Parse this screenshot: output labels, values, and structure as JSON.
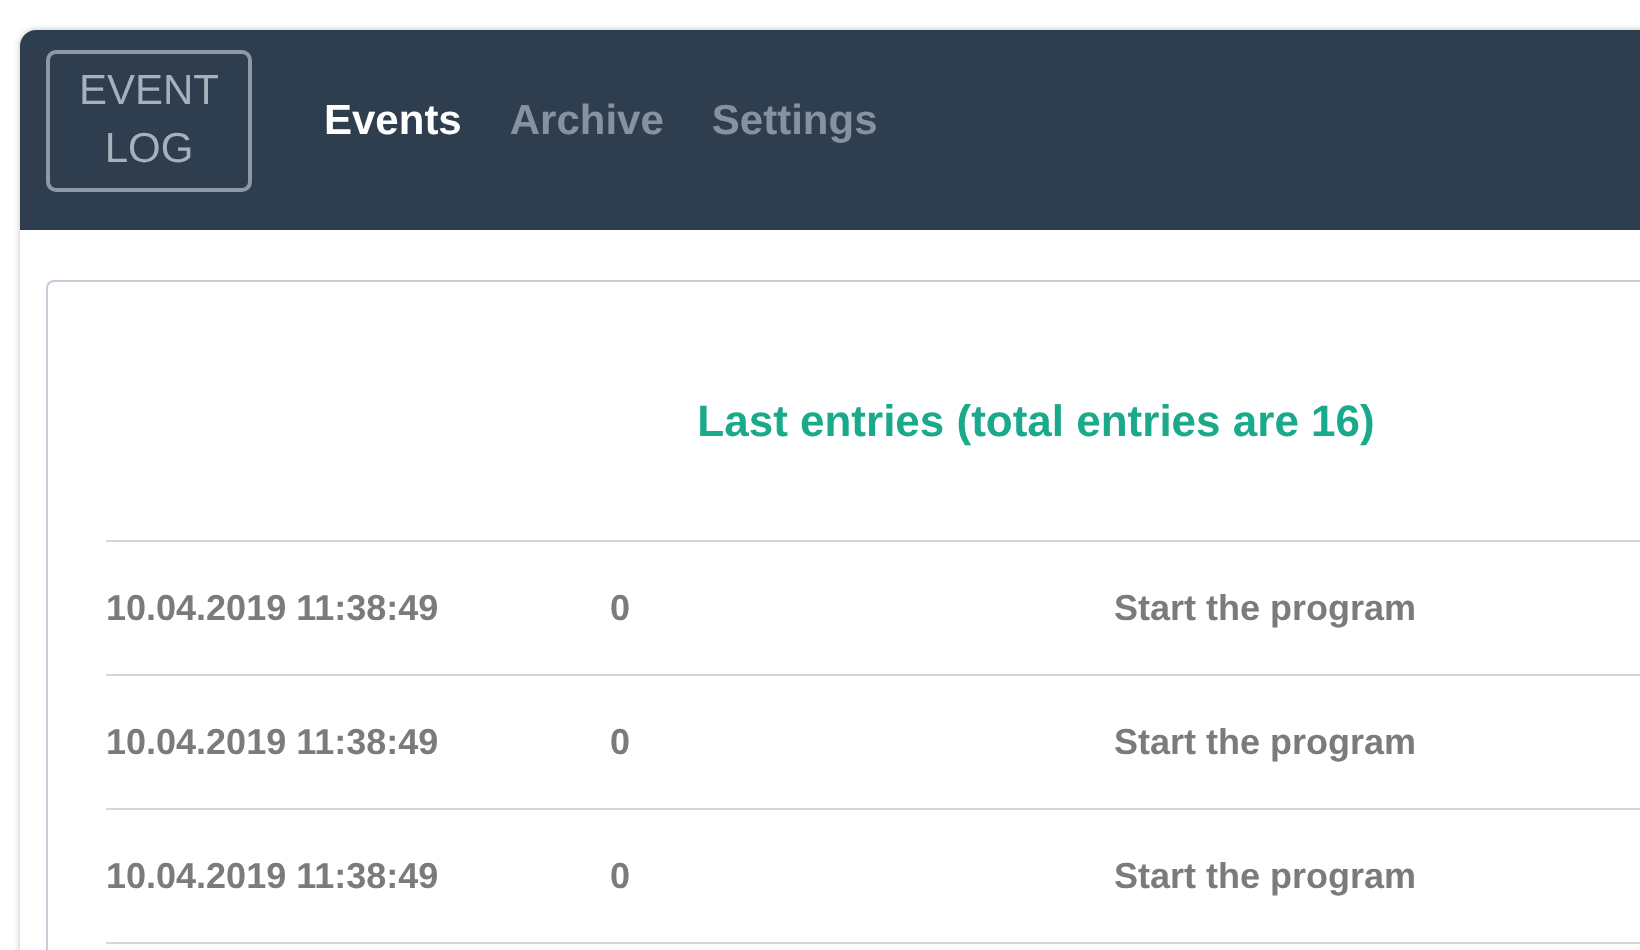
{
  "logo": {
    "lines": [
      "EVENT",
      "LOG"
    ]
  },
  "tabs": [
    {
      "label": "Events",
      "selected": true
    },
    {
      "label": "Archive",
      "selected": false
    },
    {
      "label": "Settings",
      "selected": false
    }
  ],
  "panel": {
    "title": "Last entries (total entries are 16)",
    "rows": [
      {
        "time": "10.04.2019 11:38:49",
        "code": "0",
        "message": "Start the program"
      },
      {
        "time": "10.04.2019 11:38:49",
        "code": "0",
        "message": "Start the program"
      },
      {
        "time": "10.04.2019 11:38:49",
        "code": "0",
        "message": "Start the program"
      }
    ]
  }
}
